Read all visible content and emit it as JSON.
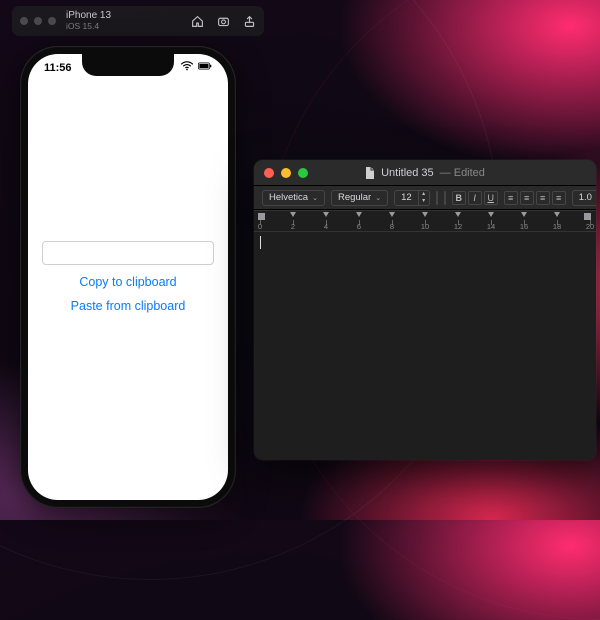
{
  "simulator": {
    "device": "iPhone 13",
    "os": "iOS 15.4",
    "icons": [
      "home-icon",
      "screenshot-icon",
      "export-icon"
    ]
  },
  "phone": {
    "time": "11:56",
    "field_value": "",
    "field_placeholder": "",
    "copy_label": "Copy to clipboard",
    "paste_label": "Paste from clipboard"
  },
  "textedit": {
    "title": "Untitled 35",
    "title_suffix": "— Edited",
    "font_family": "Helvetica",
    "font_style": "Regular",
    "font_size": "12",
    "line_spacing": "1.0",
    "text_color": "#000000",
    "bg_color": "#ffffff",
    "ruler_labels": [
      "0",
      "2",
      "4",
      "6",
      "8",
      "10",
      "12",
      "14",
      "16",
      "18",
      "20"
    ],
    "content": ""
  }
}
